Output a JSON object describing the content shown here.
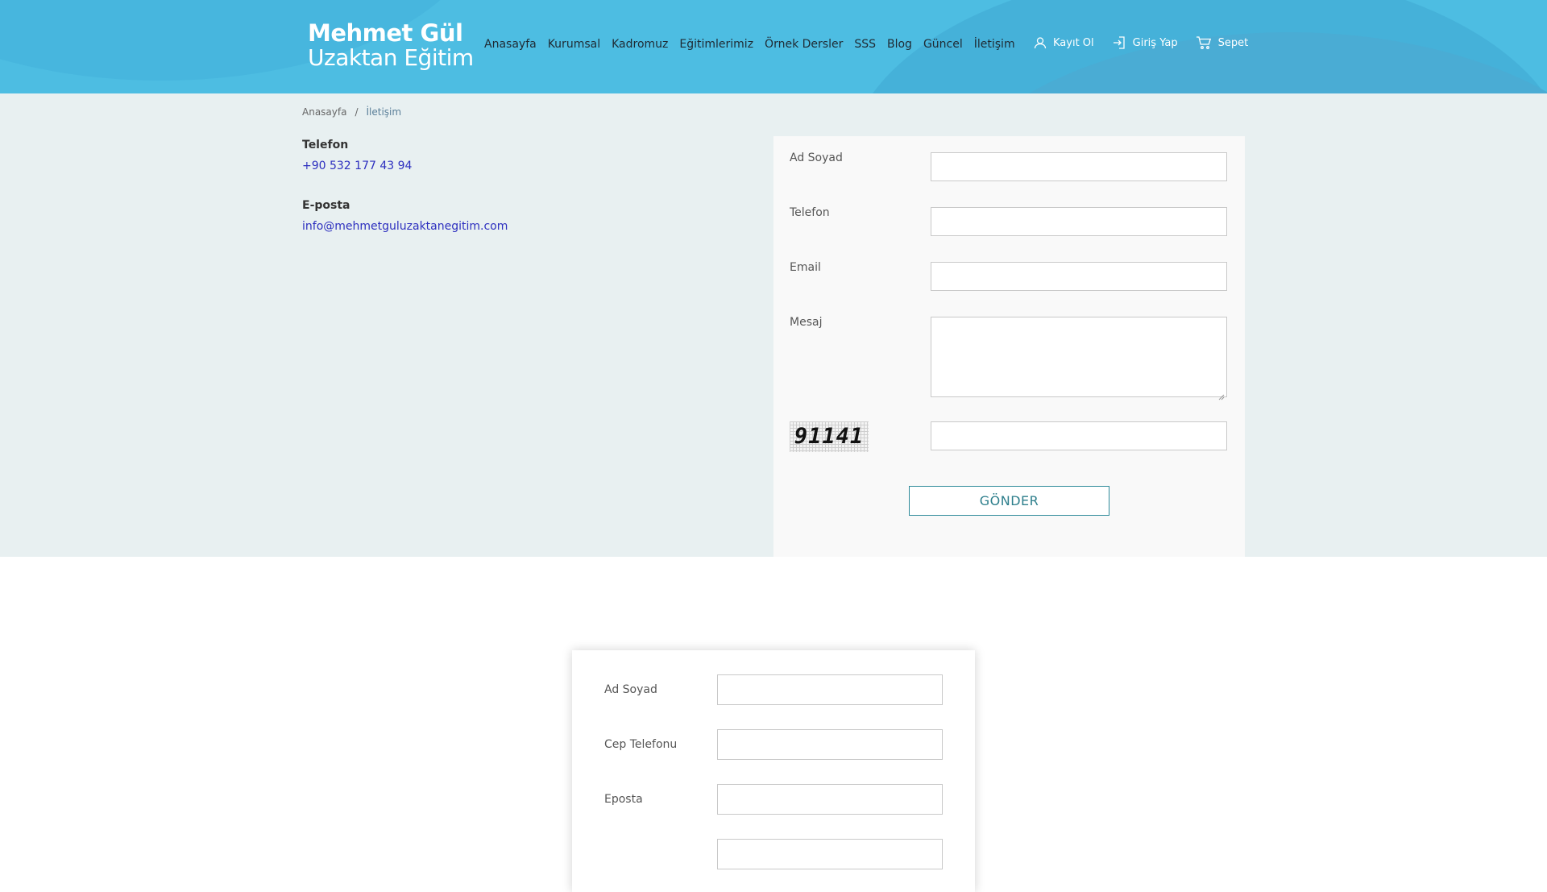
{
  "header": {
    "logo_line1": "Mehmet Gül",
    "logo_line2": "Uzaktan Eğitim",
    "nav": [
      "Anasayfa",
      "Kurumsal",
      "Kadromuz",
      "Eğitimlerimiz",
      "Örnek Dersler",
      "SSS",
      "Blog",
      "Güncel",
      "İletişim"
    ],
    "register": "Kayıt Ol",
    "login": "Giriş Yap",
    "cart": "Sepet",
    "colors": {
      "bar": "#4dbde2",
      "nav_text": "#1f2a33",
      "light_text": "#ffffff"
    }
  },
  "breadcrumb": {
    "home": "Anasayfa",
    "separator": "/",
    "current": "İletişim"
  },
  "contact": {
    "phone_label": "Telefon",
    "phone": "+90 532 177 43 94",
    "email_label": "E-posta",
    "email": "info@mehmetguluzaktanegitim.com"
  },
  "contact_form": {
    "name_label": "Ad Soyad",
    "phone_label": "Telefon",
    "email_label": "Email",
    "message_label": "Mesaj",
    "captcha_text": "91141",
    "submit_label": "GÖNDER"
  },
  "lower_form": {
    "name_label": "Ad Soyad",
    "mobile_label": "Cep Telefonu",
    "email_label": "Eposta"
  }
}
